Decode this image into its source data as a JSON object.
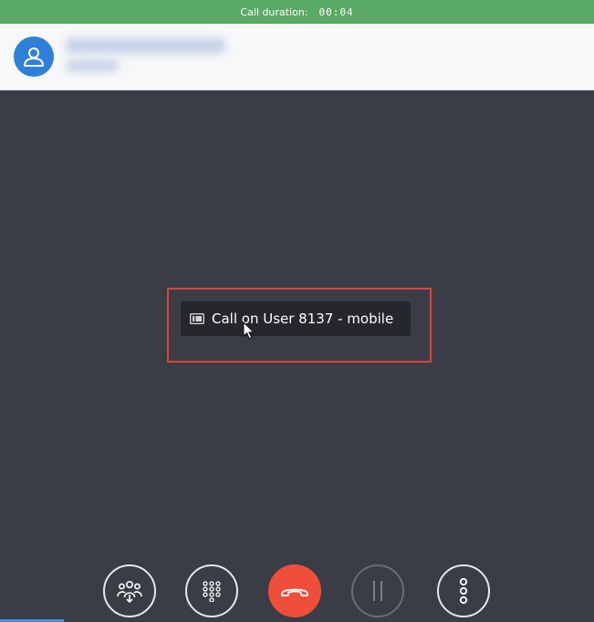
{
  "call_status": {
    "duration_label": "Call duration:",
    "duration_value": "00:04"
  },
  "contact": {
    "avatar_icon": "user-icon"
  },
  "device_tooltip": {
    "icon": "phone-device-icon",
    "label": "Call on User 8137 - mobile"
  },
  "controls": [
    {
      "name": "conference-button",
      "icon": "group-icon"
    },
    {
      "name": "dialpad-button",
      "icon": "dialpad-icon"
    },
    {
      "name": "hangup-button",
      "icon": "hangup-icon"
    },
    {
      "name": "hold-button",
      "icon": "pause-icon",
      "state": "disabled"
    },
    {
      "name": "more-button",
      "icon": "more-vertical-icon"
    }
  ],
  "colors": {
    "status_bar": "#5aaa66",
    "avatar": "#2f80d8",
    "hangup": "#ef4e3a",
    "highlight": "#e0403a",
    "stage": "#3a3d45"
  }
}
